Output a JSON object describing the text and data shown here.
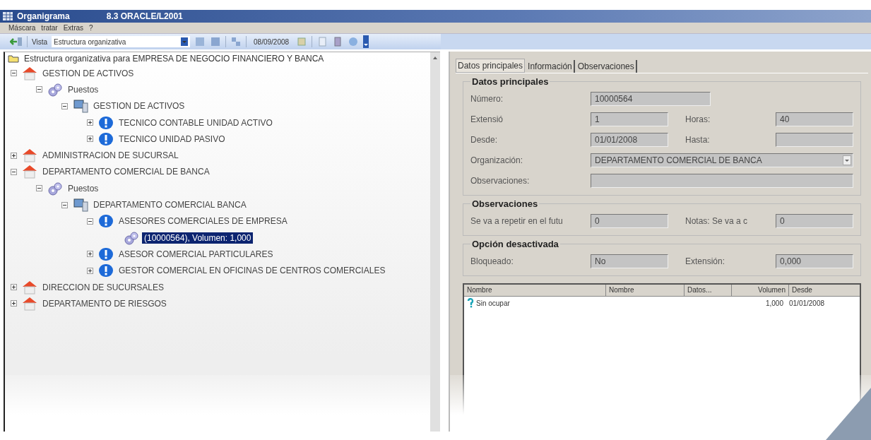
{
  "window": {
    "title": "Organigrama",
    "version": "8.3  ORACLE/L2001"
  },
  "menu": [
    {
      "label": "Máscara"
    },
    {
      "label": "tratar"
    },
    {
      "label": "Extras"
    },
    {
      "label": "?"
    }
  ],
  "toolbar": {
    "view_label": "Vista",
    "view_value": "Estructura organizativa",
    "date": "08/09/2008"
  },
  "tree": {
    "root": "Estructura organizativa para EMPRESA DE NEGOCIO FINANCIERO Y BANCA",
    "items": [
      {
        "kind": "unit",
        "label": "GESTION DE ACTIVOS",
        "expanded": true,
        "selected": false,
        "children": [
          {
            "kind": "positions",
            "label": "Puestos",
            "expanded": true,
            "selected": false,
            "children": [
              {
                "kind": "department",
                "label": "GESTION DE ACTIVOS",
                "expanded": true,
                "selected": false,
                "children": [
                  {
                    "kind": "job",
                    "label": "TECNICO CONTABLE UNIDAD ACTIVO",
                    "expanded": false,
                    "selected": false
                  },
                  {
                    "kind": "job",
                    "label": "TECNICO UNIDAD PASIVO",
                    "expanded": false,
                    "selected": false
                  }
                ]
              }
            ]
          }
        ]
      },
      {
        "kind": "unit",
        "label": "ADMINISTRACION DE SUCURSAL",
        "expanded": false,
        "selected": false
      },
      {
        "kind": "unit",
        "label": "DEPARTAMENTO COMERCIAL DE BANCA",
        "expanded": true,
        "selected": false,
        "children": [
          {
            "kind": "positions",
            "label": "Puestos",
            "expanded": true,
            "selected": false,
            "children": [
              {
                "kind": "department",
                "label": "DEPARTAMENTO COMERCIAL BANCA",
                "expanded": true,
                "selected": false,
                "children": [
                  {
                    "kind": "job",
                    "label": "ASESORES COMERCIALES DE EMPRESA",
                    "expanded": true,
                    "selected": false,
                    "children": [
                      {
                        "kind": "position",
                        "label": "(10000564), Volumen: 1,000",
                        "selected": true
                      }
                    ]
                  },
                  {
                    "kind": "job",
                    "label": "ASESOR COMERCIAL PARTICULARES",
                    "expanded": false,
                    "selected": false
                  },
                  {
                    "kind": "job",
                    "label": "GESTOR COMERCIAL EN OFICINAS DE CENTROS COMERCIALES",
                    "expanded": false,
                    "selected": false
                  }
                ]
              }
            ]
          }
        ]
      },
      {
        "kind": "unit",
        "label": "DIRECCION DE SUCURSALES",
        "expanded": false,
        "selected": false
      },
      {
        "kind": "unit",
        "label": "DEPARTAMENTO DE RIESGOS",
        "expanded": false,
        "selected": false
      }
    ]
  },
  "tabs": [
    {
      "label": "Datos principales",
      "selected": true
    },
    {
      "label": "Información",
      "selected": false
    },
    {
      "label": "Observaciones",
      "selected": false
    }
  ],
  "groups": [
    {
      "title": "Datos principales",
      "rows": [
        [
          {
            "label": "Número:",
            "value": "10000564",
            "kind": "text"
          }
        ],
        [
          {
            "label": "Extensió",
            "value": "1",
            "kind": "text"
          },
          {
            "label": "Horas:",
            "value": "40",
            "kind": "text"
          }
        ],
        [
          {
            "label": "Desde:",
            "value": "01/01/2008",
            "kind": "text"
          },
          {
            "label": "Hasta:",
            "kind": "text"
          }
        ],
        [
          {
            "label": "Organización:",
            "value": "DEPARTAMENTO COMERCIAL DE BANCA",
            "kind": "dropdown"
          }
        ],
        [
          {
            "label": "Observaciones:",
            "kind": "text"
          }
        ]
      ]
    },
    {
      "title": "Observaciones",
      "rows": [
        [
          {
            "label": "Se va a repetir en el futu",
            "value": "0",
            "kind": "text"
          },
          {
            "label": "Notas: Se va a c",
            "value": "0",
            "kind": "text"
          }
        ]
      ]
    },
    {
      "title": "Opción desactivada",
      "rows": [
        [
          {
            "label": "Bloqueado:",
            "value": "No",
            "kind": "text"
          },
          {
            "label": "Extensión:",
            "value": "0,000",
            "kind": "text"
          }
        ]
      ]
    }
  ],
  "table": {
    "columns": [
      "Nombre",
      "Nombre",
      "Datos...",
      "Volumen",
      "Desde"
    ],
    "rows": [
      {
        "cells": [
          "Sin ocupar",
          "",
          "",
          "1,000",
          "01/01/2008"
        ]
      }
    ]
  }
}
